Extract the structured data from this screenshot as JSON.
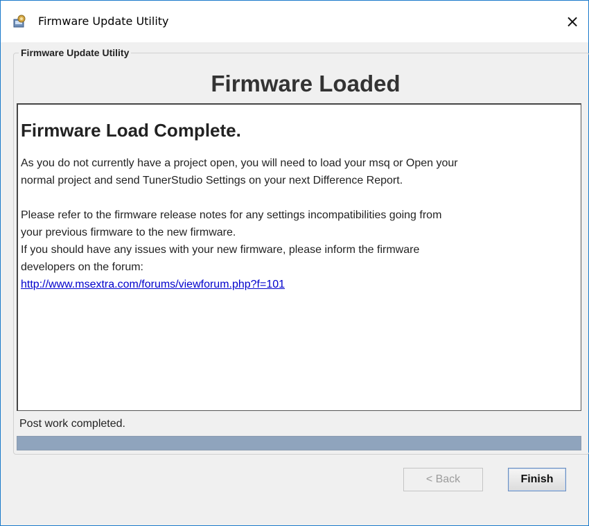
{
  "window": {
    "title": "Firmware Update Utility",
    "close_symbol": "×",
    "icon": "app-icon"
  },
  "group": {
    "legend": "Firmware Update Utility"
  },
  "page": {
    "title": "Firmware Loaded"
  },
  "content": {
    "heading": "Firmware Load Complete.",
    "paragraph1_line1": "As you do not currently have a project open, you will need to load your msq or Open your",
    "paragraph1_line2": "normal project and send TunerStudio Settings on your next Difference Report.",
    "paragraph2_line1": "Please refer to the firmware release notes for any settings incompatibilities going from",
    "paragraph2_line2": "your previous firmware to the new firmware.",
    "paragraph3_line1": "If you should have any issues with your new firmware, please inform the firmware",
    "paragraph3_line2": "developers on the forum:",
    "forum_link": "http://www.msextra.com/forums/viewforum.php?f=101"
  },
  "status": {
    "text": "Post work completed.",
    "progress": 1.0
  },
  "buttons": {
    "back_label": "< Back",
    "finish_label": "Finish"
  },
  "colors": {
    "link": "#0000cc",
    "progress_fill": "#8fa4bd",
    "window_border": "#1979ca"
  }
}
